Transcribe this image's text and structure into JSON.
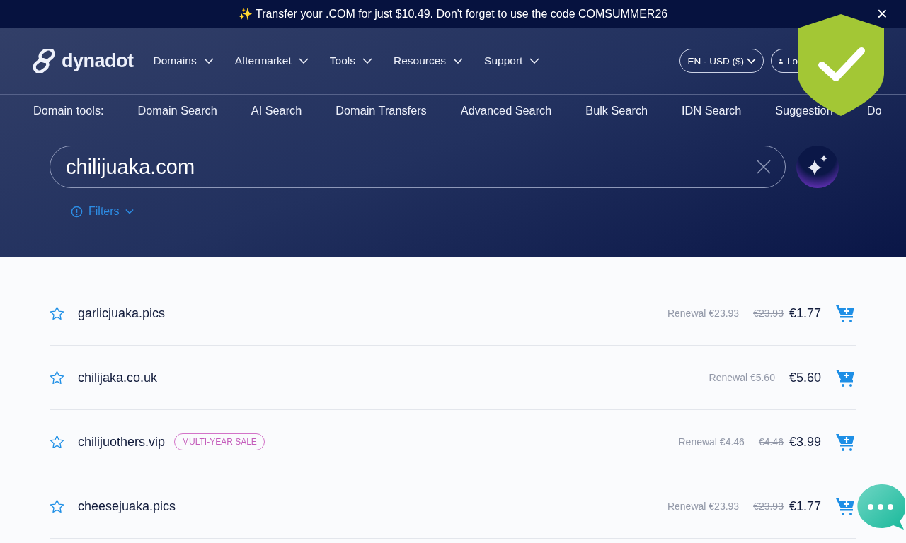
{
  "banner": {
    "icon": "✨",
    "text": "Transfer your .COM for just $10.49. Don't forget to use the code COMSUMMER26",
    "close": "×"
  },
  "header": {
    "logo": "dynadot",
    "nav": [
      {
        "label": "Domains"
      },
      {
        "label": "Aftermarket"
      },
      {
        "label": "Tools"
      },
      {
        "label": "Resources"
      },
      {
        "label": "Support"
      }
    ],
    "language": "EN - USD ($)",
    "login": "Lo"
  },
  "domain_tools": {
    "label": "Domain tools:",
    "items": [
      {
        "label": "Domain Search"
      },
      {
        "label": "AI Search"
      },
      {
        "label": "Domain Transfers"
      },
      {
        "label": "Advanced Search"
      },
      {
        "label": "Bulk Search"
      },
      {
        "label": "IDN Search"
      },
      {
        "label": "Suggestion"
      },
      {
        "label": "Do"
      }
    ]
  },
  "search": {
    "value": "chilijuaka.com",
    "filters": "Filters"
  },
  "results": [
    {
      "domain": "garlicjuaka.pics",
      "favorite": false,
      "renewal": "Renewal €23.93",
      "old_price": "€23.93",
      "price": "€1.77"
    },
    {
      "domain": "chilijaka.co.uk",
      "favorite": false,
      "renewal": "Renewal €5.60",
      "price": "€5.60"
    },
    {
      "domain": "chilijuothers.vip",
      "favorite": false,
      "tag": "MULTI-YEAR SALE",
      "renewal": "Renewal €4.46",
      "old_price": "€4.46",
      "price": "€3.99"
    },
    {
      "domain": "cheesejuaka.pics",
      "favorite": false,
      "renewal": "Renewal €23.93",
      "old_price": "€23.93",
      "price": "€1.77"
    }
  ]
}
